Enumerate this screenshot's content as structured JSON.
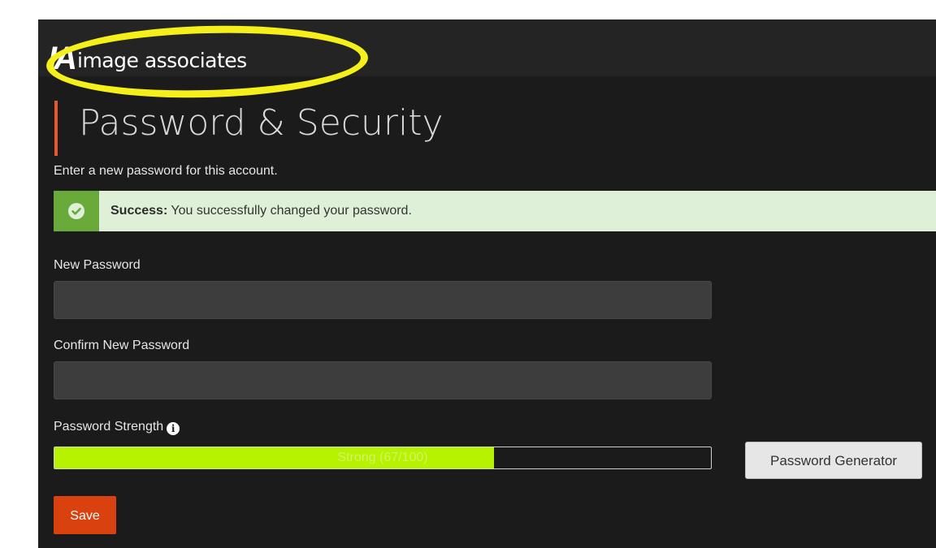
{
  "header": {
    "logo_mark": "IA",
    "logo_text": "image associates"
  },
  "page": {
    "title": "Password & Security",
    "intro": "Enter a new password for this account."
  },
  "alert": {
    "type": "success",
    "icon": "check-circle-icon",
    "heading": "Success:",
    "message": " You successfully changed your password."
  },
  "form": {
    "new_password_label": "New Password",
    "new_password_value": "",
    "confirm_password_label": "Confirm New Password",
    "confirm_password_value": "",
    "strength_label": "Password Strength",
    "strength_info_icon": "info-icon",
    "strength_text": "Strong (67/100)",
    "strength_score": 67,
    "strength_max": 100,
    "generator_button": "Password Generator",
    "save_button": "Save"
  },
  "colors": {
    "accent": "#e8582c",
    "save_button": "#d9410e",
    "strength_fill": "#b7f200",
    "alert_background": "#dff0d8",
    "alert_icon_background": "#6aaa3a",
    "highlight_annotation": "#f5ef1a"
  }
}
